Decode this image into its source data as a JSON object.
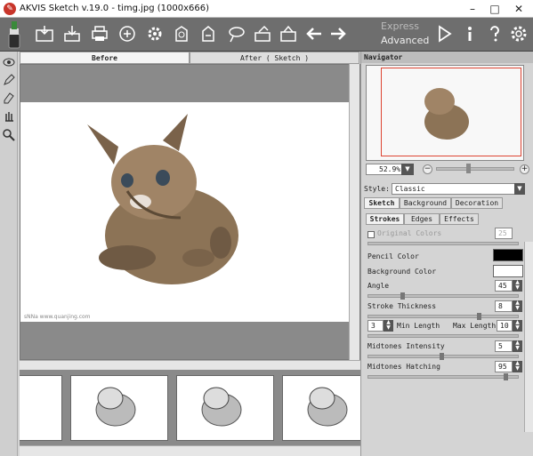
{
  "window": {
    "title": "AKVIS Sketch v.19.0 - timg.jpg (1000x666)",
    "minimize": "–",
    "maximize": "□",
    "close": "✕"
  },
  "toolbar": {
    "icons": [
      "open-image-icon",
      "save-icon",
      "print-icon",
      "share-icon",
      "settings-gear-icon",
      "batch-icon",
      "plugin-icon",
      "presets-icon",
      "upload-icon",
      "export-icon",
      "undo-icon",
      "redo-icon",
      "run-icon",
      "info-icon",
      "help-icon",
      "preferences-icon"
    ],
    "mode_express": "Express",
    "mode_advanced": "Advanced"
  },
  "view_tabs": {
    "before": "Before",
    "after": "After ( Sketch )"
  },
  "photo_watermark": "sNNa  www.quanjing.com",
  "navigator": {
    "title": "Navigator",
    "zoom": "52.9%"
  },
  "settings": {
    "style_label": "Style:",
    "style_value": "Classic",
    "main_tabs": [
      "Sketch",
      "Background",
      "Decoration"
    ],
    "sub_tabs": [
      "Strokes",
      "Edges",
      "Effects"
    ],
    "original_colors_label": "Original Colors",
    "original_colors_value": "25",
    "pencil_color_label": "Pencil Color",
    "pencil_color": "#000000",
    "background_color_label": "Background Color",
    "background_color": "#ffffff",
    "angle_label": "Angle",
    "angle_value": "45",
    "stroke_thickness_label": "Stroke Thickness",
    "stroke_thickness_value": "8",
    "min_length_value": "3",
    "min_length_label": "Min Length",
    "max_length_label": "Max Length",
    "max_length_value": "10",
    "midtones_intensity_label": "Midtones Intensity",
    "midtones_intensity_value": "5",
    "midtones_hatching_label": "Midtones Hatching",
    "midtones_hatching_value": "95"
  }
}
